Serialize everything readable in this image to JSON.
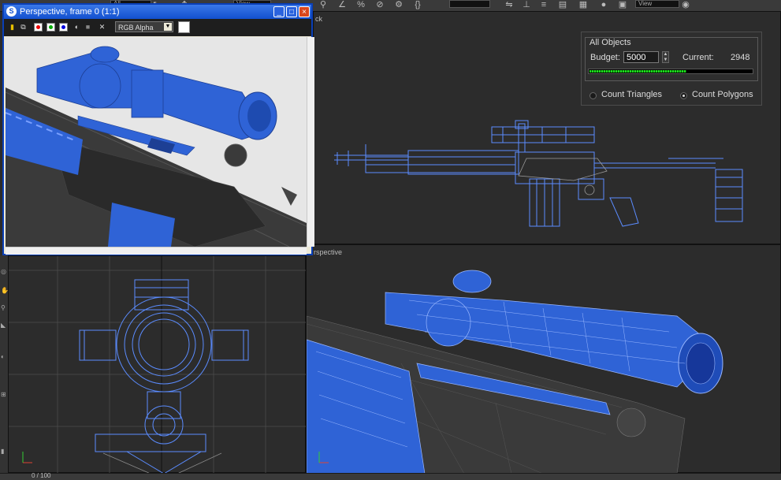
{
  "toolbar": {
    "dropdown_left": "All",
    "dropdown_view_1": "View",
    "dropdown_view_2": "View"
  },
  "render_window": {
    "title": "Perspective, frame 0 (1:1)",
    "app_icon": "3ds-max-icon",
    "minimize_glyph": "_",
    "maximize_glyph": "□",
    "close_glyph": "×",
    "channel": "RGB Alpha",
    "channel_arrow": "▼",
    "toolbar_icons": [
      "save-icon",
      "clone-icon",
      "red-channel-icon",
      "green-channel-icon",
      "blue-channel-icon",
      "alpha-icon",
      "mono-icon",
      "clear-icon"
    ]
  },
  "viewports": {
    "top_right_label": "ck",
    "bottom_right_label": "rspective"
  },
  "polygon_counter": {
    "group_label": "All Objects",
    "budget_label": "Budget:",
    "budget_value": "5000",
    "current_label": "Current:",
    "current_value": "2948",
    "progress": 0.59,
    "option_triangles": "Count Triangles",
    "option_polygons": "Count Polygons",
    "selected_option": "polygons"
  },
  "colors": {
    "mesh_blue": "#2f63d6",
    "wire_blue": "#5b8cff",
    "progress_green": "#1ee11e",
    "titlebar": "#1250cf"
  },
  "status": {
    "bottom_text": "0 / 100"
  }
}
